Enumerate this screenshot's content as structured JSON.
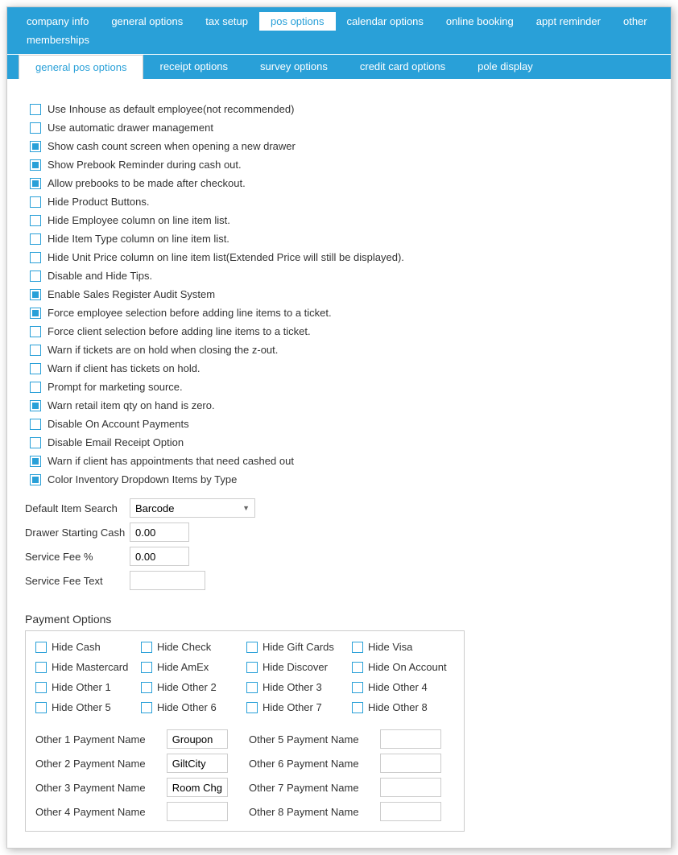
{
  "topNav": {
    "items": [
      {
        "label": "company info",
        "active": false
      },
      {
        "label": "general options",
        "active": false
      },
      {
        "label": "tax setup",
        "active": false
      },
      {
        "label": "pos options",
        "active": true
      },
      {
        "label": "calendar options",
        "active": false
      },
      {
        "label": "online booking",
        "active": false
      },
      {
        "label": "appt reminder",
        "active": false
      },
      {
        "label": "other",
        "active": false
      },
      {
        "label": "memberships",
        "active": false
      }
    ]
  },
  "subNav": {
    "items": [
      {
        "label": "general pos options",
        "active": true
      },
      {
        "label": "receipt options",
        "active": false
      },
      {
        "label": "survey options",
        "active": false
      },
      {
        "label": "credit card options",
        "active": false
      },
      {
        "label": "pole display",
        "active": false
      }
    ]
  },
  "checkboxes": [
    {
      "label": "Use Inhouse as default employee(not recommended)",
      "checked": false
    },
    {
      "label": "Use automatic drawer management",
      "checked": false
    },
    {
      "label": "Show cash count screen when opening a new drawer",
      "checked": true
    },
    {
      "label": "Show Prebook Reminder during cash out.",
      "checked": true
    },
    {
      "label": "Allow prebooks to be made after checkout.",
      "checked": true
    },
    {
      "label": "Hide Product Buttons.",
      "checked": false
    },
    {
      "label": "Hide Employee column on line item list.",
      "checked": false
    },
    {
      "label": "Hide Item Type column on line item list.",
      "checked": false
    },
    {
      "label": "Hide Unit Price column on line item list(Extended Price will still be displayed).",
      "checked": false
    },
    {
      "label": "Disable and Hide Tips.",
      "checked": false
    },
    {
      "label": "Enable Sales Register Audit System",
      "checked": true
    },
    {
      "label": "Force employee selection before adding line items to a ticket.",
      "checked": true
    },
    {
      "label": "Force client selection before adding line items to a ticket.",
      "checked": false
    },
    {
      "label": "Warn if tickets are on hold when closing the z-out.",
      "checked": false
    },
    {
      "label": "Warn if client has tickets on hold.",
      "checked": false
    },
    {
      "label": "Prompt for marketing source.",
      "checked": false
    },
    {
      "label": "Warn retail item qty on hand is zero.",
      "checked": true
    },
    {
      "label": "Disable On Account Payments",
      "checked": false
    },
    {
      "label": "Disable Email Receipt Option",
      "checked": false
    },
    {
      "label": "Warn if client has appointments that need cashed out",
      "checked": true
    },
    {
      "label": "Color Inventory Dropdown Items by Type",
      "checked": true
    }
  ],
  "fields": {
    "defaultItemSearch": {
      "label": "Default Item Search",
      "value": "Barcode"
    },
    "drawerStartingCash": {
      "label": "Drawer Starting Cash",
      "value": "0.00"
    },
    "serviceFeePercent": {
      "label": "Service Fee %",
      "value": "0.00"
    },
    "serviceFeeText": {
      "label": "Service Fee Text",
      "value": ""
    }
  },
  "paymentSection": {
    "title": "Payment Options",
    "hideOptions": [
      {
        "label": "Hide Cash",
        "checked": false
      },
      {
        "label": "Hide Check",
        "checked": false
      },
      {
        "label": "Hide Gift Cards",
        "checked": false
      },
      {
        "label": "Hide Visa",
        "checked": false
      },
      {
        "label": "Hide Mastercard",
        "checked": false
      },
      {
        "label": "Hide AmEx",
        "checked": false
      },
      {
        "label": "Hide Discover",
        "checked": false
      },
      {
        "label": "Hide On Account",
        "checked": false
      },
      {
        "label": "Hide Other 1",
        "checked": false
      },
      {
        "label": "Hide Other 2",
        "checked": false
      },
      {
        "label": "Hide Other 3",
        "checked": false
      },
      {
        "label": "Hide Other 4",
        "checked": false
      },
      {
        "label": "Hide Other 5",
        "checked": false
      },
      {
        "label": "Hide Other 6",
        "checked": false
      },
      {
        "label": "Hide Other 7",
        "checked": false
      },
      {
        "label": "Hide Other 8",
        "checked": false
      }
    ],
    "nameFields": [
      {
        "label": "Other 1 Payment Name",
        "value": "Groupon"
      },
      {
        "label": "Other 2 Payment Name",
        "value": "GiltCity"
      },
      {
        "label": "Other 3 Payment Name",
        "value": "Room Chg"
      },
      {
        "label": "Other 4 Payment Name",
        "value": ""
      },
      {
        "label": "Other 5 Payment Name",
        "value": ""
      },
      {
        "label": "Other 6 Payment Name",
        "value": ""
      },
      {
        "label": "Other 7 Payment Name",
        "value": ""
      },
      {
        "label": "Other 8 Payment Name",
        "value": ""
      }
    ]
  }
}
